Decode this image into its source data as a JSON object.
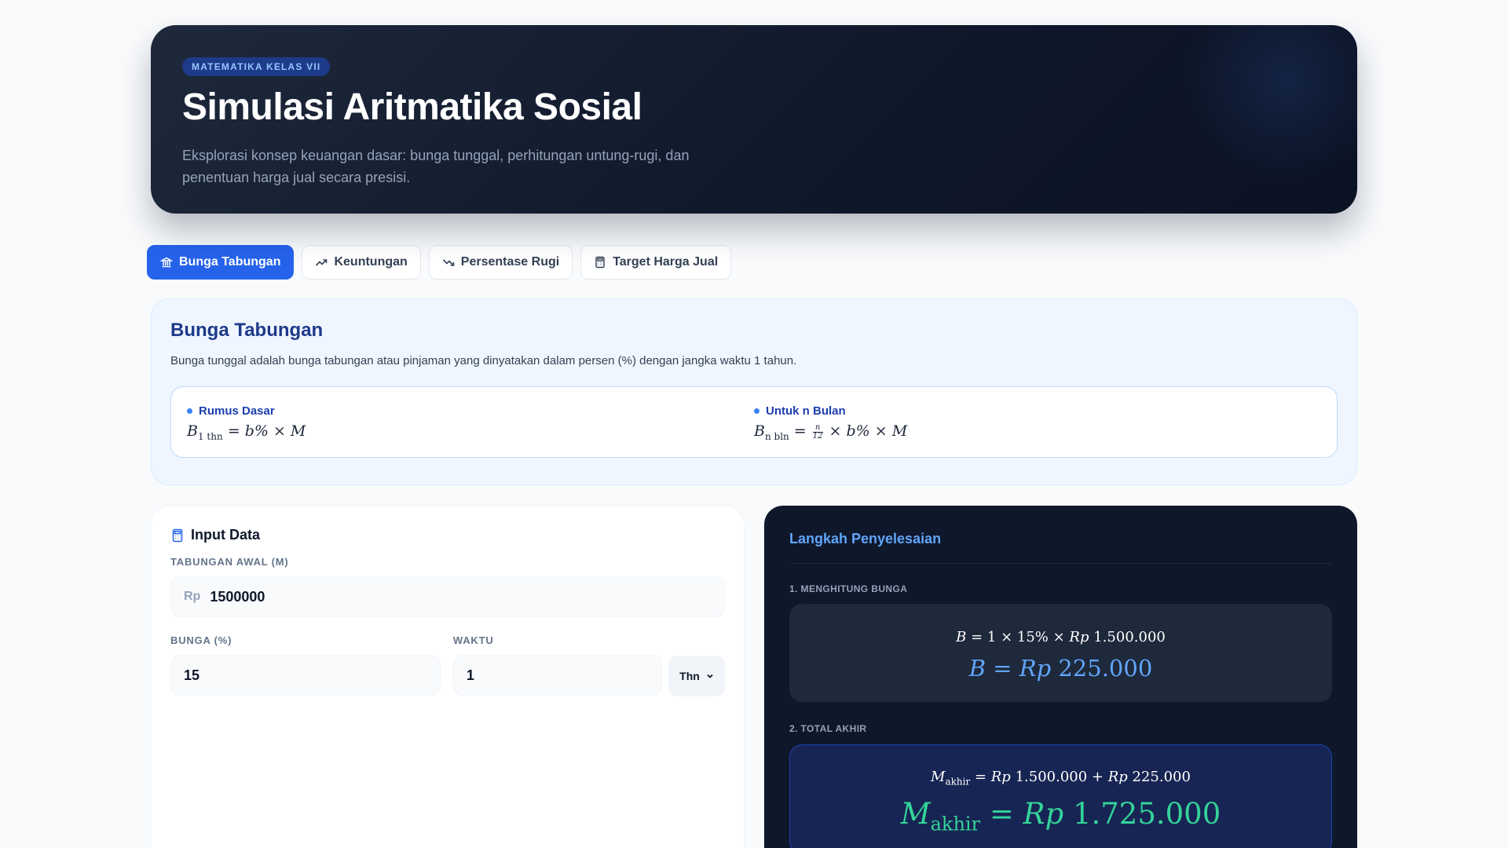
{
  "hero": {
    "badge": "MATEMATIKA KELAS VII",
    "title": "Simulasi Aritmatika Sosial",
    "subtitle": "Eksplorasi konsep keuangan dasar: bunga tunggal, perhitungan untung-rugi, dan penentuan harga jual secara presisi."
  },
  "tabs": [
    {
      "label": "Bunga Tabungan",
      "icon": "bank-icon",
      "active": true
    },
    {
      "label": "Keuntungan",
      "icon": "trending-up-icon",
      "active": false
    },
    {
      "label": "Persentase Rugi",
      "icon": "trending-down-icon",
      "active": false
    },
    {
      "label": "Target Harga Jual",
      "icon": "calculator-icon",
      "active": false
    }
  ],
  "info": {
    "title": "Bunga Tabungan",
    "description": "Bunga tunggal adalah bunga tabungan atau pinjaman yang dinyatakan dalam persen (%) dengan jangka waktu 1 tahun.",
    "formulas": [
      {
        "label": "Rumus Dasar"
      },
      {
        "label": "Untuk n Bulan"
      }
    ]
  },
  "input": {
    "title": "Input Data",
    "savings_label": "TABUNGAN AWAL (M)",
    "savings_prefix": "Rp",
    "savings_value": "1500000",
    "rate_label": "BUNGA (%)",
    "rate_value": "15",
    "time_label": "WAKTU",
    "time_value": "1",
    "time_unit": "Thn"
  },
  "steps": {
    "title": "Langkah Penyelesaian",
    "step1_label": "1. MENGHITUNG BUNGA",
    "step1_expr": "1 × 15% × ",
    "step1_amount": "1.500.000",
    "step1_result": "225.000",
    "step2_label": "2. TOTAL AKHIR",
    "step2_a": "1.500.000",
    "step2_b": "225.000",
    "step2_result": "1.725.000",
    "currency": "Rp",
    "sub_akhir": "akhir"
  },
  "colors": {
    "accent": "#2563eb",
    "hero_bg": "#0f172a",
    "result_blue": "#60a5fa",
    "result_green": "#34d399"
  }
}
